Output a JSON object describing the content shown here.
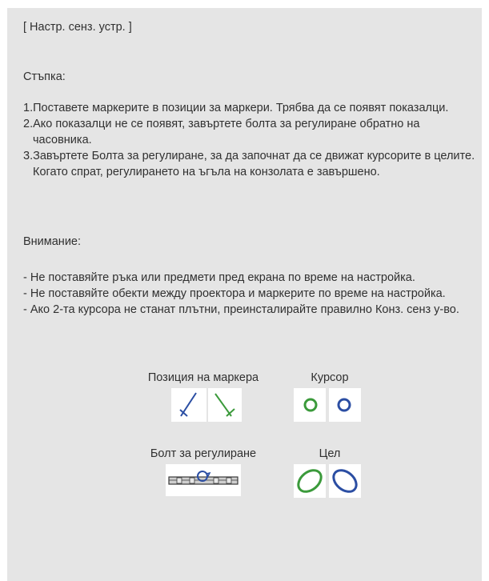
{
  "screen": {
    "title": "[ Настр. сенз. устр. ]",
    "steps_heading": "Стъпка:",
    "steps": [
      "1.Поставете маркерите в позиции за маркери. Трябва да се появят показалци.",
      "2.Ако показалци не се появят, завъртете болта за регулиране обратно на часовника.",
      "3.Завъртете Болта за регулиране, за да започнат да се движат курсорите в целите. Когато спрат, регулирането на ъгъла на конзолата е завършено."
    ],
    "warning_heading": "Внимание:",
    "warnings": [
      "- Не поставяйте ръка или предмети пред екрана по време на настройка.",
      "- Не поставяйте обекти между проектора и маркерите по време на настройка.",
      "- Ако 2-та курсора не станат плътни, преинсталирайте правилно Конз. сенз у-во."
    ],
    "legend": {
      "marker_position_label": "Позиция на маркера",
      "cursor_label": "Курсор",
      "adjust_bolt_label": "Болт за регулиране",
      "target_label": "Цел"
    },
    "colors": {
      "panel_bg": "#e5e5e5",
      "text": "#303030",
      "blue": "#2b4ea3",
      "green": "#3b9a3b"
    },
    "icons": [
      "marker-blue-icon",
      "marker-green-icon",
      "cursor-green-icon",
      "cursor-blue-icon",
      "adjust-bolt-icon",
      "target-green-icon",
      "target-blue-icon"
    ]
  }
}
